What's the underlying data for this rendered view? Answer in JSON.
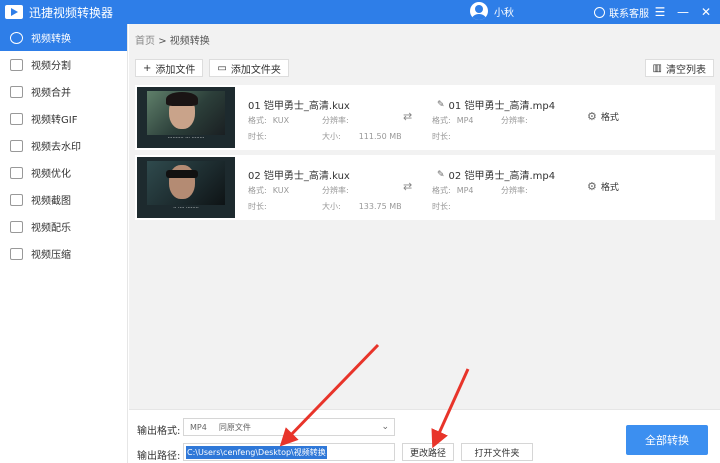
{
  "app": {
    "title": "迅捷视频转换器",
    "user_name": "小秋",
    "service_label": "联系客服",
    "accent": "#2e7ee8"
  },
  "window_controls": [
    "☰",
    "—",
    "✕"
  ],
  "sidebar": {
    "items": [
      {
        "label": "视频转换",
        "active": true
      },
      {
        "label": "视频分割"
      },
      {
        "label": "视频合并"
      },
      {
        "label": "视频转GIF"
      },
      {
        "label": "视频去水印"
      },
      {
        "label": "视频优化"
      },
      {
        "label": "视频截图"
      },
      {
        "label": "视频配乐"
      },
      {
        "label": "视频压缩"
      }
    ]
  },
  "breadcrumb": {
    "home": "首页",
    "sep": ">",
    "current": "视频转换"
  },
  "toolbar": {
    "add_file": "添加文件",
    "add_folder": "添加文件夹",
    "clear_list": "清空列表"
  },
  "files": [
    {
      "src_name": "01 铠甲勇士_高清.kux",
      "src_format_label": "格式:",
      "src_format": "KUX",
      "src_res_label": "分辨率:",
      "src_duration_label": "时长:",
      "src_size_label": "大小:",
      "src_size": "111.50 MB",
      "dst_name": "01 铠甲勇士_高清.mp4",
      "dst_format_label": "格式:",
      "dst_format": "MP4",
      "dst_res_label": "分辨率:",
      "dst_duration_label": "时长:",
      "format_button": "格式"
    },
    {
      "src_name": "02 铠甲勇士_高清.kux",
      "src_format_label": "格式:",
      "src_format": "KUX",
      "src_res_label": "分辨率:",
      "src_duration_label": "时长:",
      "src_size_label": "大小:",
      "src_size": "133.75 MB",
      "dst_name": "02 铠甲勇士_高清.mp4",
      "dst_format_label": "格式:",
      "dst_format": "MP4",
      "dst_res_label": "分辨率:",
      "dst_duration_label": "时长:",
      "format_button": "格式"
    }
  ],
  "output": {
    "format_label": "输出格式:",
    "format_value": "MP4",
    "format_quality": "同原文件",
    "path_label": "输出路径:",
    "path_value": "C:\\Users\\cenfeng\\Desktop\\视频转换",
    "change_path": "更改路径",
    "open_folder": "打开文件夹",
    "convert_all": "全部转换"
  }
}
